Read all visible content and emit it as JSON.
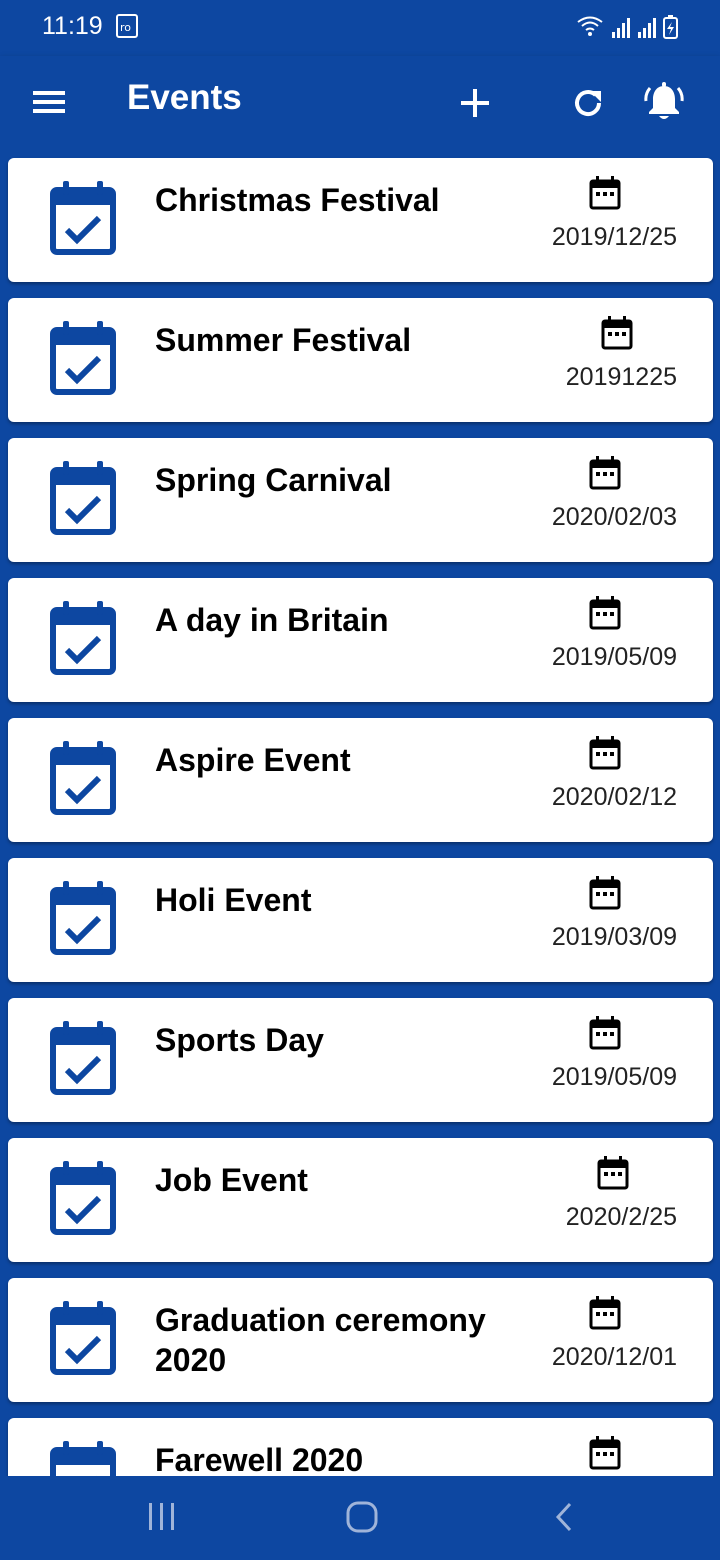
{
  "status_bar": {
    "time": "11:19"
  },
  "app_bar": {
    "title": "Events",
    "menu_icon": "menu-icon",
    "add_icon": "plus-icon",
    "refresh_icon": "refresh-icon",
    "notification_icon": "bell-icon"
  },
  "events": [
    {
      "title": "Christmas Festival",
      "date": "2019/12/25"
    },
    {
      "title": "Summer Festival",
      "date": "20191225"
    },
    {
      "title": "Spring Carnival",
      "date": "2020/02/03"
    },
    {
      "title": "A day in Britain",
      "date": "2019/05/09"
    },
    {
      "title": "Aspire Event",
      "date": "2020/02/12"
    },
    {
      "title": "Holi Event",
      "date": "2019/03/09"
    },
    {
      "title": "Sports Day",
      "date": "2019/05/09"
    },
    {
      "title": "Job Event",
      "date": "2020/2/25"
    },
    {
      "title": "Graduation ceremony 2020",
      "date": "2020/12/01"
    },
    {
      "title": "Farewell 2020",
      "date": ""
    }
  ],
  "colors": {
    "primary": "#0d47a1",
    "card": "#ffffff",
    "text": "#000000"
  }
}
